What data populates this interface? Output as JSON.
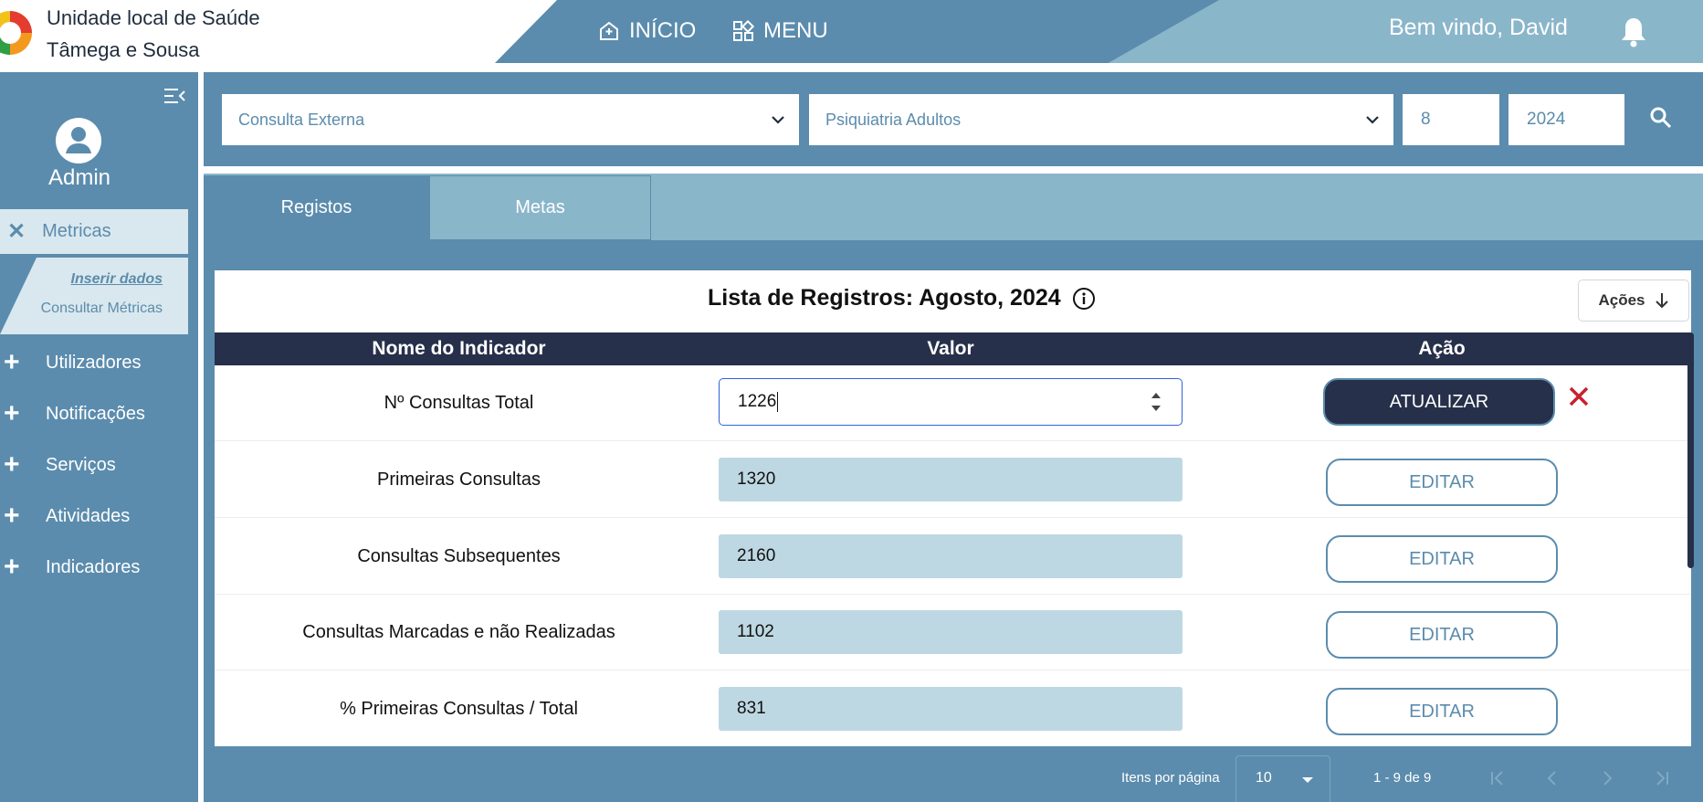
{
  "header": {
    "brand_line1": "Unidade local de Saúde",
    "brand_line2": "Tâmega e Sousa",
    "nav": [
      {
        "label": "INÍCIO",
        "icon": "home-plus-icon"
      },
      {
        "label": "MENU",
        "icon": "grid-menu-icon"
      }
    ],
    "welcome": "Bem vindo, David"
  },
  "colors": {
    "primary": "#5b8cad",
    "light": "#8ab6ca",
    "dark": "#27304a",
    "accent_blue": "#2f63d8",
    "danger": "#c8202f",
    "value_bg": "#bed8e3"
  },
  "sidebar": {
    "user": "Admin",
    "active_item": "Metricas",
    "submenu": [
      "Inserir dados",
      "Consultar Métricas"
    ],
    "items": [
      "Utilizadores",
      "Notificações",
      "Serviços",
      "Atividades",
      "Indicadores"
    ]
  },
  "filters": {
    "type": "Consulta Externa",
    "service": "Psiquiatria Adultos",
    "month": "8",
    "year": "2024"
  },
  "tabs": [
    "Registos",
    "Metas"
  ],
  "list": {
    "title": "Lista de Registros: Agosto, 2024",
    "actions_label": "Ações",
    "columns": [
      "Nome do Indicador",
      "Valor",
      "Ação"
    ],
    "rows": [
      {
        "name": "Nº Consultas Total",
        "value": "1226",
        "action": "ATUALIZAR"
      },
      {
        "name": "Primeiras Consultas",
        "value": "1320",
        "action": "EDITAR"
      },
      {
        "name": "Consultas Subsequentes",
        "value": "2160",
        "action": "EDITAR"
      },
      {
        "name": "Consultas Marcadas e não Realizadas",
        "value": "1102",
        "action": "EDITAR"
      },
      {
        "name": "% Primeiras Consultas / Total",
        "value": "831",
        "action": "EDITAR"
      }
    ]
  },
  "pagination": {
    "label": "Itens por página",
    "page_size": "10",
    "range": "1 - 9 de 9"
  }
}
